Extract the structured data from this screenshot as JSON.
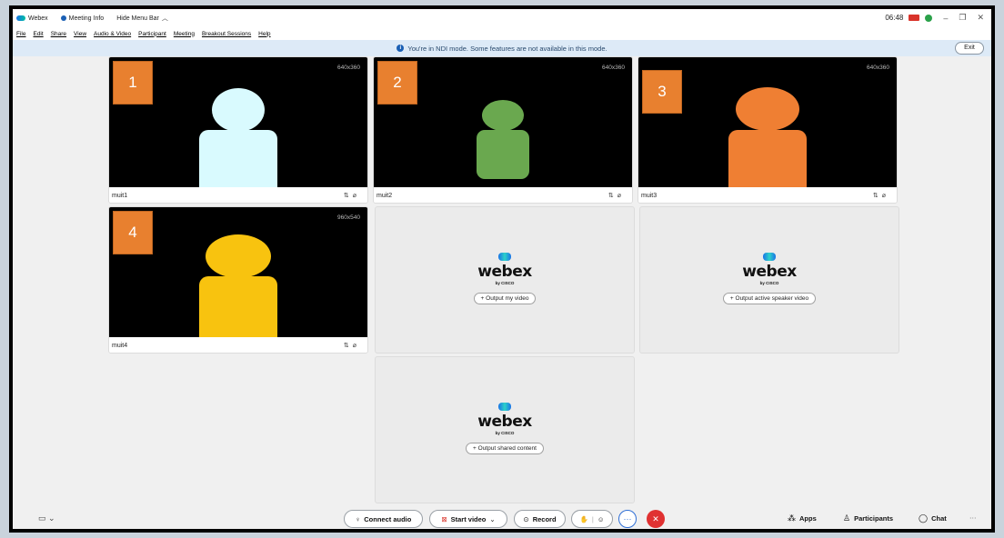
{
  "titlebar": {
    "app_name": "Webex",
    "meeting_info": "Meeting Info",
    "hide_menu": "Hide Menu Bar",
    "time": "06:48",
    "minimize": "–",
    "restore": "❐",
    "close": "✕"
  },
  "menu": [
    "File",
    "Edit",
    "Share",
    "View",
    "Audio & Video",
    "Participant",
    "Meeting",
    "Breakout Sessions",
    "Help"
  ],
  "banner": {
    "message": "You're in NDI mode. Some features are not available in this mode.",
    "exit_label": "Exit"
  },
  "tiles": [
    {
      "number": "1",
      "resolution": "640x360",
      "name": "muit1",
      "color": "#d9fafe"
    },
    {
      "number": "2",
      "resolution": "640x360",
      "name": "muit2",
      "color": "#6aa84f"
    },
    {
      "number": "3",
      "resolution": "640x360",
      "name": "muit3",
      "color": "#ef7f33"
    },
    {
      "number": "4",
      "resolution": "960x540",
      "name": "muit4",
      "color": "#f8c30f"
    }
  ],
  "placeholders": [
    {
      "brand": "webex",
      "sub": "by CISCO",
      "button": "+ Output my video"
    },
    {
      "brand": "webex",
      "sub": "by CISCO",
      "button": "+ Output active speaker video"
    },
    {
      "brand": "webex",
      "sub": "by CISCO",
      "button": "+ Output shared content"
    }
  ],
  "controls": {
    "connect_audio": "Connect audio",
    "start_video": "Start video",
    "record": "Record",
    "apps": "Apps",
    "participants": "Participants",
    "chat": "Chat",
    "more": "···"
  }
}
